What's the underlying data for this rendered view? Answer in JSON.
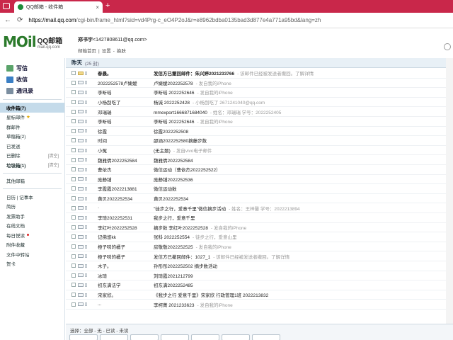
{
  "browser": {
    "tab_title": "QQ邮箱 - 收件箱",
    "new_tab_symbol": "+",
    "close_symbol": "×",
    "url_host": "https://mail.qq.com",
    "url_rest": "/cgi-bin/frame_html?sid=vd4Prg-c_eO4P2oJ&r=e8962bdba0135bad3d877e4a771a95bd&lang=zh"
  },
  "header": {
    "logo_mail": "MOil",
    "logo_qq": "QQ邮箱",
    "logo_domain": "mail.qq.com",
    "user_name": "郑书宇",
    "user_email": "<1427808611@qq.com>",
    "links": [
      "邮箱首页",
      "|",
      "设置",
      "-",
      "换肤"
    ]
  },
  "sidebar": {
    "buttons": [
      {
        "label": "写信",
        "icon": "pen-icon"
      },
      {
        "label": "收信",
        "icon": "inbox-icon"
      },
      {
        "label": "通讯录",
        "icon": "contacts-icon"
      }
    ],
    "folders": [
      {
        "label": "收件箱(7)",
        "active": true,
        "bold": true,
        "extra": ""
      },
      {
        "label": "星标邮件",
        "star": true,
        "extra": ""
      },
      {
        "label": "群邮件",
        "extra": ""
      },
      {
        "label": "草稿箱(2)",
        "extra": ""
      },
      {
        "label": "已发送",
        "extra": ""
      },
      {
        "label": "已删除",
        "extra": "[清空]"
      },
      {
        "label": "垃圾箱(1)",
        "bold": true,
        "extra": "[清空]"
      }
    ],
    "folders2": [
      {
        "label": "其他邮箱"
      }
    ],
    "tools": [
      {
        "label": "日历 | 记事本"
      },
      {
        "label": "简历"
      },
      {
        "label": "发票助手"
      },
      {
        "label": "在线文档"
      },
      {
        "label": "每日悦读",
        "dot": true
      },
      {
        "label": "附件收藏"
      },
      {
        "label": "文件中转站"
      },
      {
        "label": "贺卡"
      }
    ]
  },
  "inbox": {
    "group_title": "昨天",
    "group_count": "(25 封)",
    "rows": [
      {
        "sender": "春晨。",
        "subject": "发信方已撤回邮件：朱兴婷2021233766",
        "preview": "- 该邮件已经被发送者撤回。了解详情",
        "unread": true
      },
      {
        "sender": "2022252578卢婕嫒",
        "subject": "卢婕嫒2022252578",
        "preview": "- 发自我的iPhone"
      },
      {
        "sender": "李昕瑶",
        "subject": "李昕瑶 2022252646",
        "preview": "- 发自我的iPhone"
      },
      {
        "sender": "小杨刮吃了",
        "subject": "杨诚 2022252428",
        "preview": "- 小杨刮吃了 2671241040@qq.com"
      },
      {
        "sender": "邓瑞瑞",
        "subject": "mmexport1666871684040",
        "preview": "- 姓名：邓瑞瑞 学号：2022252405"
      },
      {
        "sender": "李昕瑶",
        "subject": "李昕瑶 2022252646",
        "preview": "- 发自我的iPhone"
      },
      {
        "sender": "徐霞",
        "subject": "徐霞2022252508",
        "preview": ""
      },
      {
        "sender": "时间",
        "subject": "邵涵2022252580摘藤步数",
        "preview": ""
      },
      {
        "sender": "小冤",
        "subject": "(无主题)",
        "preview": "- 发自vivo电子邮件"
      },
      {
        "sender": "魏雅倩2022252584",
        "subject": "魏雅倩2022252584",
        "preview": ""
      },
      {
        "sender": "曹依杰",
        "subject": "微信运动（曹依杰2022252522）",
        "preview": ""
      },
      {
        "sender": "庞静铺",
        "subject": "庞静铺2022252536",
        "preview": ""
      },
      {
        "sender": "李霞霞2022213881",
        "subject": "微信运动数",
        "preview": ""
      },
      {
        "sender": "黄贝2022252534",
        "subject": "黄贝2022252534",
        "preview": ""
      },
      {
        "sender": "·",
        "subject": "\"徒步之行，爱意千里\"微信摘步活动",
        "preview": "- 姓名：王梓馨 学号：2022213894"
      },
      {
        "sender": "李琦2022252531",
        "subject": "我步之行，爱意千里",
        "preview": ""
      },
      {
        "sender": "李红叶2022252528",
        "subject": "摘步数 李红叶2022252528",
        "preview": "- 发自我的iPhone"
      },
      {
        "sender": "记佛悠kk",
        "subject": "张科 2022252554",
        "preview": "- 徒步之行，爱意山里"
      },
      {
        "sender": "橙子味的橘子",
        "subject": "房敬敬2022252525",
        "preview": "- 发自我的iPhone"
      },
      {
        "sender": "橙子味的橘子",
        "subject": "发信方已撤回邮件：1027_1",
        "preview": "- 该邮件已经被发送者撤回。了解详情"
      },
      {
        "sender": "木子。",
        "subject": "孙彤彤2022252502 摘步数活动",
        "preview": ""
      },
      {
        "sender": "冰琦",
        "subject": "刘琦霞2021212799",
        "preview": ""
      },
      {
        "sender": "初东满法学",
        "subject": "初东满2022252485",
        "preview": ""
      },
      {
        "sender": "宋家欣。",
        "subject": "《我步之行 爱意千里》宋家欣 行政管理1班 2022213832",
        "preview": ""
      },
      {
        "sender": "...",
        "subject": "李柯菁 2021233623",
        "preview": "- 发自我的iPhone"
      }
    ]
  },
  "footer": {
    "select_label": "选择：全部 - 无 - 已读 - 未读"
  }
}
